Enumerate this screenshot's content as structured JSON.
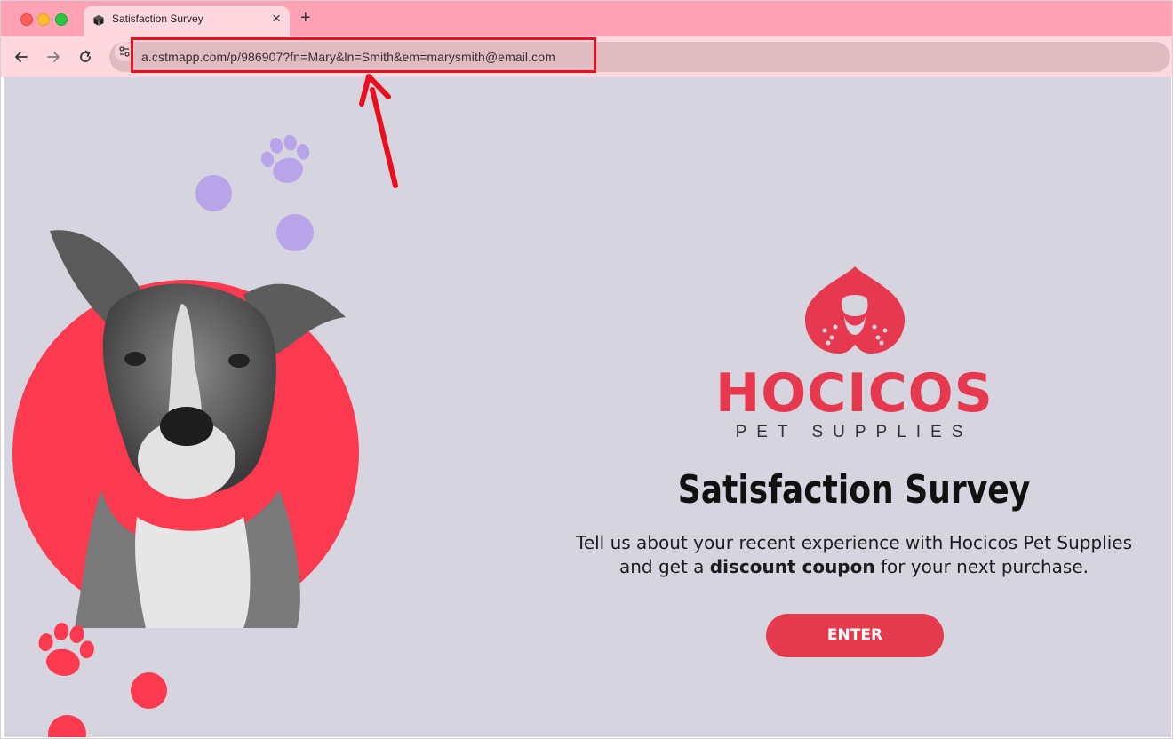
{
  "browser": {
    "tab": {
      "title": "Satisfaction Survey",
      "favicon": "cube-icon",
      "close": "×"
    },
    "new_tab": "+",
    "nav": {
      "back": "back-arrow-icon",
      "forward": "forward-arrow-icon",
      "reload": "reload-icon",
      "site_info": "tune-icon"
    },
    "url": "a.cstmapp.com/p/986907?fn=Mary&ln=Smith&em=marysmith@email.com"
  },
  "page": {
    "brand": {
      "name": "HOCICOS",
      "tagline": "PET SUPPLIES"
    },
    "title": "Satisfaction Survey",
    "description_line1": "Tell us about your recent experience with Hocicos Pet Supplies",
    "description_pre": "and get a ",
    "description_bold": "discount coupon",
    "description_post": " for your next purchase.",
    "enter_button": "ENTER"
  },
  "colors": {
    "tab_strip": "#ffa2b5",
    "toolbar": "#ffd7df",
    "page_background": "#d6d4df",
    "brand_red": "#e6394f",
    "paw_purple": "#b8a4e9",
    "annotation_red": "#e8101e"
  }
}
